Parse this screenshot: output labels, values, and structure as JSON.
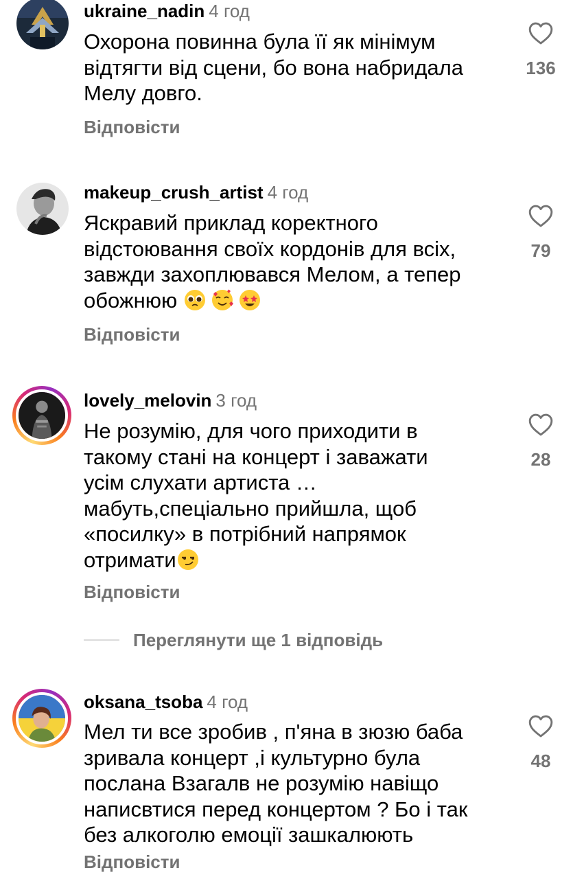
{
  "comments": [
    {
      "username": "ukraine_nadin",
      "time": "4 год",
      "text": "Охорона повинна була її як мінімум\nвідтягти від сцени, бо вона набридала\nМелу довго.",
      "reply": "Відповісти",
      "likes": "136",
      "avatar": "ukraine-art-avatar"
    },
    {
      "username": "makeup_crush_artist",
      "time": "4 год",
      "text": "Яскравий приклад коректного\nвідстоювання своїх кордонів для всіх,\nзавжди захоплювався Мелом, а тепер\nобожнюю ",
      "reply": "Відповісти",
      "likes": "79",
      "emojis": [
        "pleading-face-emoji",
        "smiling-face-with-hearts-emoji",
        "star-struck-emoji"
      ],
      "avatar": "bw-portrait-avatar"
    },
    {
      "username": "lovely_melovin",
      "time": "3 год",
      "text": "Не розумію, для чого приходити в\nтакому стані на концерт і заважати\nусім слухати артиста …\nмабуть,спеціально прийшла, щоб\n«посилку»  в потрібний напрямок\nотримати",
      "reply": "Відповісти",
      "likes": "28",
      "emojis": [
        "smirking-face-emoji"
      ],
      "avatar": "stage-performer-avatar"
    },
    {
      "username": "oksana_tsoba",
      "time": "4 год",
      "text": "Мел ти все  зробив , п'яна в зюзю баба\nзривала концерт ,і культурно була\nпослана  Взагалв не розумію навіщо\nнаписвтися перед концертом ? Бо і так\nбез алкоголю емоції зашкалюють",
      "reply": "Відповісти",
      "likes": "48",
      "avatar": "woman-flag-avatar"
    }
  ],
  "view_more_replies": "Переглянути ще 1 відповідь",
  "colors": {
    "secondary_text": "#737373",
    "divider": "#dbdbdb"
  }
}
